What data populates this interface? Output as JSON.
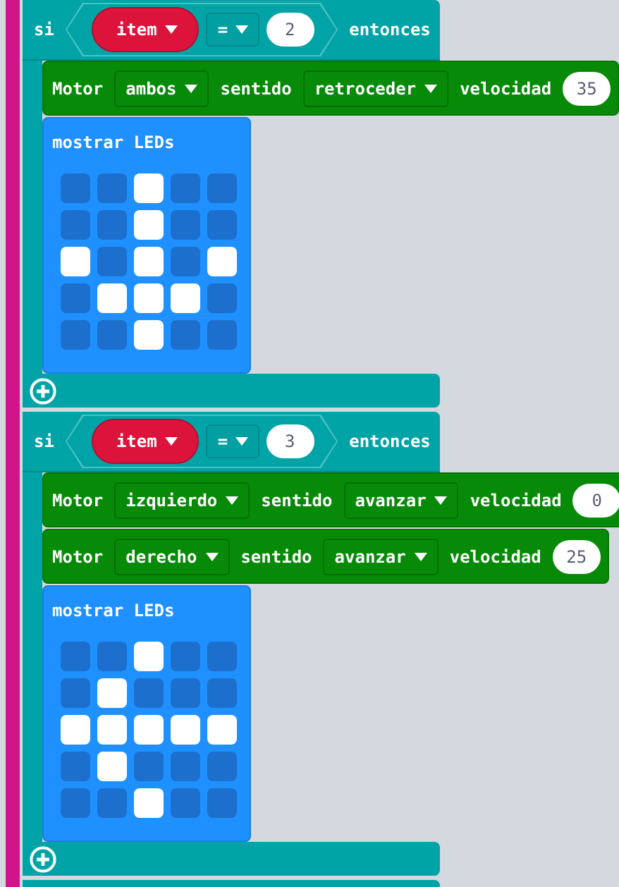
{
  "if_blocks": [
    {
      "keyword": "si",
      "condition": {
        "variable": "item",
        "operator": "=",
        "value": "2"
      },
      "then_label": "entonces",
      "body": [
        {
          "kind": "motor",
          "label": "Motor",
          "motor": "ambos",
          "direction_label": "sentido",
          "direction": "retroceder",
          "speed_label": "velocidad",
          "speed": "35"
        },
        {
          "kind": "leds",
          "label": "mostrar LEDs",
          "leds": [
            [
              false,
              false,
              true,
              false,
              false
            ],
            [
              false,
              false,
              true,
              false,
              false
            ],
            [
              true,
              false,
              true,
              false,
              true
            ],
            [
              false,
              true,
              true,
              true,
              false
            ],
            [
              false,
              false,
              true,
              false,
              false
            ]
          ]
        }
      ]
    },
    {
      "keyword": "si",
      "condition": {
        "variable": "item",
        "operator": "=",
        "value": "3"
      },
      "then_label": "entonces",
      "body": [
        {
          "kind": "motor",
          "label": "Motor",
          "motor": "izquierdo",
          "direction_label": "sentido",
          "direction": "avanzar",
          "speed_label": "velocidad",
          "speed": "0"
        },
        {
          "kind": "motor",
          "label": "Motor",
          "motor": "derecho",
          "direction_label": "sentido",
          "direction": "avanzar",
          "speed_label": "velocidad",
          "speed": "25"
        },
        {
          "kind": "leds",
          "label": "mostrar LEDs",
          "leds": [
            [
              false,
              false,
              true,
              false,
              false
            ],
            [
              false,
              true,
              false,
              false,
              false
            ],
            [
              true,
              true,
              true,
              true,
              true
            ],
            [
              false,
              true,
              false,
              false,
              false
            ],
            [
              false,
              false,
              true,
              false,
              false
            ]
          ]
        }
      ]
    }
  ]
}
